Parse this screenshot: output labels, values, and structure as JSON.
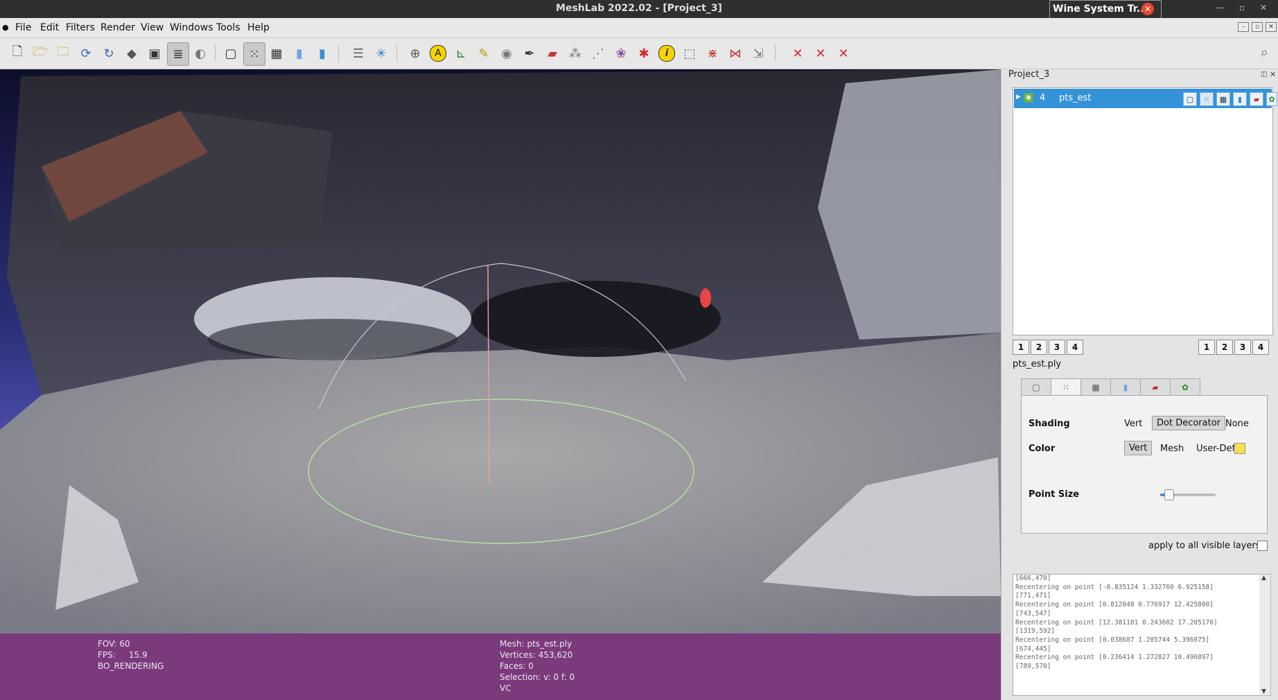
{
  "window": {
    "title": "MeshLab 2022.02 - [Project_3]"
  },
  "menubar": {
    "items": [
      "File",
      "Edit",
      "Filters",
      "Render",
      "View",
      "Windows",
      "Tools",
      "Help"
    ]
  },
  "wine_popup": {
    "title": "Wine System Tr..."
  },
  "toolbar": {
    "icons": [
      "new-project-icon",
      "open-project-icon",
      "open-mesh-icon",
      "reload-icon",
      "reload-all-icon",
      "save-icon",
      "snapshot-icon",
      "layers-icon",
      "layers-toggle-icon",
      "bbox-icon",
      "points-icon",
      "wireframe-icon",
      "flat-icon",
      "smooth-icon",
      "layer-stack-icon",
      "light-icon",
      "trackball-icon",
      "label-icon",
      "axes-icon",
      "measure-icon",
      "shader-icon",
      "paint-icon",
      "pick-icon",
      "select-points-icon",
      "select-faces-icon",
      "georef-icon",
      "no-entry-icon",
      "info-icon",
      "select-region-icon",
      "delete-vertices-icon",
      "delete-faces-icon",
      "delete-selection-icon",
      "delete-red-1-icon",
      "delete-red-2-icon",
      "delete-red-3-icon"
    ]
  },
  "viewport": {
    "status_left": {
      "fov": "FOV: 60",
      "fps": "FPS:     15.9",
      "mode": "BO_RENDERING"
    },
    "status_right": {
      "mesh": "Mesh: pts_est.ply",
      "vertices": "Vertices: 453,620",
      "faces": "Faces: 0",
      "selection": "Selection: v: 0 f: 0",
      "vc": "VC"
    }
  },
  "dock": {
    "title": "Project_3",
    "layer": {
      "id": "4",
      "name": "pts_est"
    },
    "view_buttons_left": [
      "1",
      "2",
      "3",
      "4"
    ],
    "view_buttons_right": [
      "1",
      "2",
      "3",
      "4"
    ],
    "mesh_name": "pts_est.ply",
    "panel": {
      "shading_label": "Shading",
      "shading_options": [
        "Vert",
        "Dot Decorator",
        "None"
      ],
      "shading_selected": "Dot Decorator",
      "color_label": "Color",
      "color_options": [
        "Vert",
        "Mesh",
        "User-Def"
      ],
      "color_selected": "Vert",
      "user_def_color": "#f4e04a",
      "point_size_label": "Point Size",
      "point_size_level": 0.15
    },
    "apply_all_label": "apply to all visible layers",
    "log": [
      "[666,470]",
      "Recentering on point [-0.835124 1.332760 6.925158]",
      "[771,471]",
      "Recentering on point [0.812848 0.776917 12.425800]",
      "[743,547]",
      "Recentering on point [12.381101 0.243602 17.205170]",
      "[1319,592]",
      "Recentering on point [0.038687 1.205744 5.396075]",
      "[674,445]",
      "Recentering on point [0.236414 1.272827 10.496897]",
      "[789,570]"
    ]
  },
  "colors": {
    "accent": "#3492d8",
    "status_bar": "#7a3a7c",
    "titlebar": "#2f2f2f"
  }
}
